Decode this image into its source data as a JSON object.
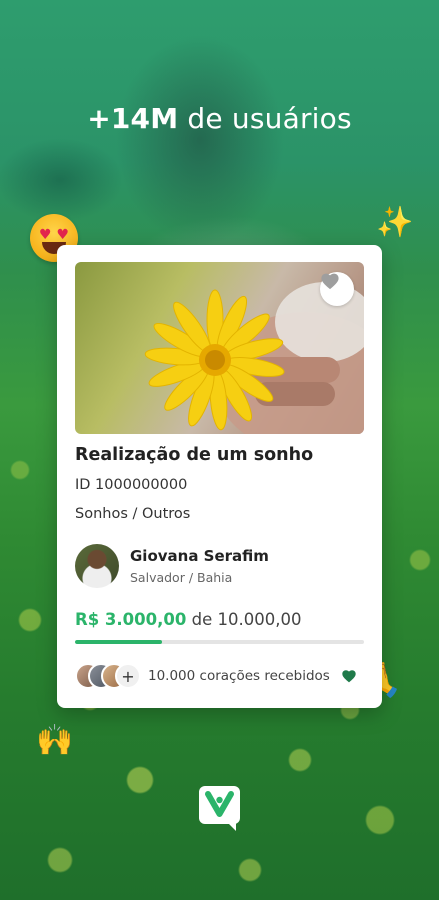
{
  "headline": {
    "bold": "+14M",
    "rest": " de usuários"
  },
  "emojis": {
    "heart_eyes": "😍",
    "sparkles": "✨",
    "pray": "🙏",
    "raised_hands": "🙌"
  },
  "card": {
    "title": "Realização de um sonho",
    "id_label": "ID 1000000000",
    "category": "Sonhos / Outros",
    "owner": {
      "name": "Giovana Serafim",
      "location": "Salvador / Bahia"
    },
    "raised_amount": "R$ 3.000,00",
    "goal_text": "de 10.000,00",
    "progress_percent": 30,
    "plus_label": "+",
    "hearts_text": "10.000 corações recebidos"
  },
  "colors": {
    "accent": "#2bb46a",
    "heart": "#1f7a4a",
    "background": "#2a8a5a"
  },
  "icons": [
    "heart-icon",
    "plus-icon",
    "logo-icon"
  ]
}
